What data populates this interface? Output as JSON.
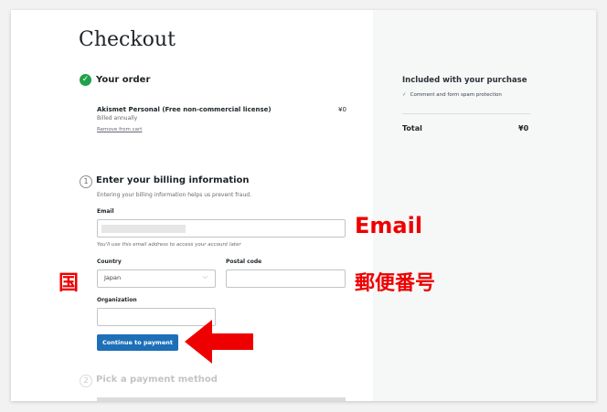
{
  "page": {
    "title": "Checkout"
  },
  "order": {
    "heading": "Your order",
    "product_name": "Akismet Personal (Free non-commercial license)",
    "billing_cycle": "Billed annually",
    "price": "¥0",
    "remove_link": "Remove from cart"
  },
  "billing": {
    "step_number": "1",
    "heading": "Enter your billing information",
    "description": "Entering your billing information helps us prevent fraud.",
    "email_label": "Email",
    "email_hint": "You'll use this email address to access your account later",
    "country_label": "Country",
    "country_value": "Japan",
    "postal_label": "Postal code",
    "postal_value": "",
    "organization_label": "Organization",
    "organization_value": "",
    "continue_label": "Continue to payment"
  },
  "payment": {
    "step_number": "2",
    "heading": "Pick a payment method"
  },
  "summary": {
    "included_title": "Included with your purchase",
    "included_items": [
      "Comment and form spam protection"
    ],
    "total_label": "Total",
    "total_value": "¥0"
  },
  "annotations": {
    "email": "Email",
    "country": "国",
    "postal": "郵便番号"
  },
  "colors": {
    "primary_button": "#1d6fb8",
    "success_green": "#1fa14b",
    "annotation_red": "#ee0000"
  },
  "icons": {
    "order_status": "check-circle-icon",
    "included_item": "check-icon",
    "country_dropdown": "chevron-down-icon",
    "annotation_pointer": "arrow-left-icon"
  }
}
